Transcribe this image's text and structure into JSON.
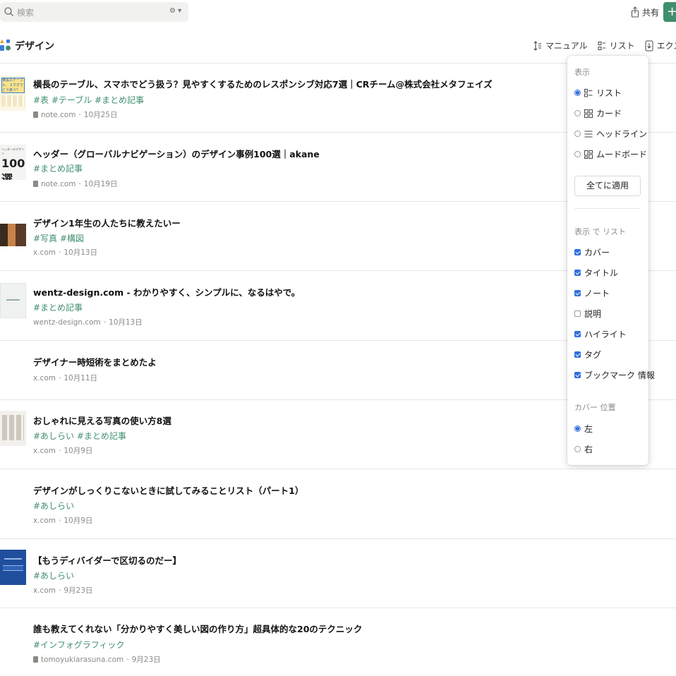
{
  "search": {
    "placeholder": "検索"
  },
  "top_actions": {
    "share_label": "共有",
    "add_label": "+"
  },
  "header": {
    "title": "デザイン"
  },
  "toolbar": {
    "sort_label": "マニュアル",
    "view_label": "リスト",
    "export_label": "エクスポート"
  },
  "items": [
    {
      "title": "横長のテーブル、スマホでどう扱う？見やすくするためのレスポンシブ対応7選｜CRチーム@株式会社メタフェイズ",
      "tags": "#表  #テーブル  #まとめ記事",
      "source": "note.com",
      "date": "10月25日",
      "thumb_text": "横長のテーブル、スマホでどう扱う？"
    },
    {
      "title": "ヘッダー（グローバルナビゲーション）のデザイン事例100選｜akane",
      "tags": "#まとめ記事",
      "source": "note.com",
      "date": "10月19日",
      "thumb_text": "100選"
    },
    {
      "title": "デザイン1年生の人たちに教えたいー",
      "tags": "#写真  #構図",
      "source": "x.com",
      "date": "10月13日"
    },
    {
      "title": "wentz-design.com - わかりやすく、シンプルに、なるはやで。",
      "tags": "#まとめ記事",
      "source": "wentz-design.com",
      "date": "10月13日"
    },
    {
      "title": "デザイナー時短術をまとめたよ",
      "tags": "",
      "source": "x.com",
      "date": "10月11日"
    },
    {
      "title": "おしゃれに見える写真の使い方8選",
      "tags": "#あしらい  #まとめ記事",
      "source": "x.com",
      "date": "10月9日"
    },
    {
      "title": "デザインがしっくりこないときに試してみることリスト（パート1）",
      "tags": "#あしらい",
      "source": "x.com",
      "date": "10月9日"
    },
    {
      "title": "【もうディバイダーで区切るのだー】",
      "tags": "#あしらい",
      "source": "x.com",
      "date": "9月23日"
    },
    {
      "title": "誰も教えてくれない「分かりやすく美しい図の作り方」超具体的な20のテクニック",
      "tags": "#インフォグラフィック",
      "source": "tomoyukiarasuna.com",
      "date": "9月23日"
    }
  ],
  "panel": {
    "display_header": "表示",
    "layout_options": [
      {
        "label": "リスト",
        "icon": "list-view-icon",
        "selected": true
      },
      {
        "label": "カード",
        "icon": "card-view-icon",
        "selected": false
      },
      {
        "label": "ヘッドライン",
        "icon": "headline-view-icon",
        "selected": false
      },
      {
        "label": "ムードボード",
        "icon": "moodboard-view-icon",
        "selected": false
      }
    ],
    "apply_all_label": "全てに適用",
    "show_in_list_header": "表示 で リスト",
    "fields": [
      {
        "label": "カバー",
        "checked": true
      },
      {
        "label": "タイトル",
        "checked": true
      },
      {
        "label": "ノート",
        "checked": true
      },
      {
        "label": "説明",
        "checked": false
      },
      {
        "label": "ハイライト",
        "checked": true
      },
      {
        "label": "タグ",
        "checked": true
      },
      {
        "label": "ブックマーク 情報",
        "checked": true
      }
    ],
    "cover_position_header": "カバー 位置",
    "cover_positions": [
      {
        "label": "左",
        "selected": true
      },
      {
        "label": "右",
        "selected": false
      }
    ]
  },
  "colors": {
    "accent_green": "#3f8f6e",
    "radio_blue": "#2f6fdc"
  }
}
